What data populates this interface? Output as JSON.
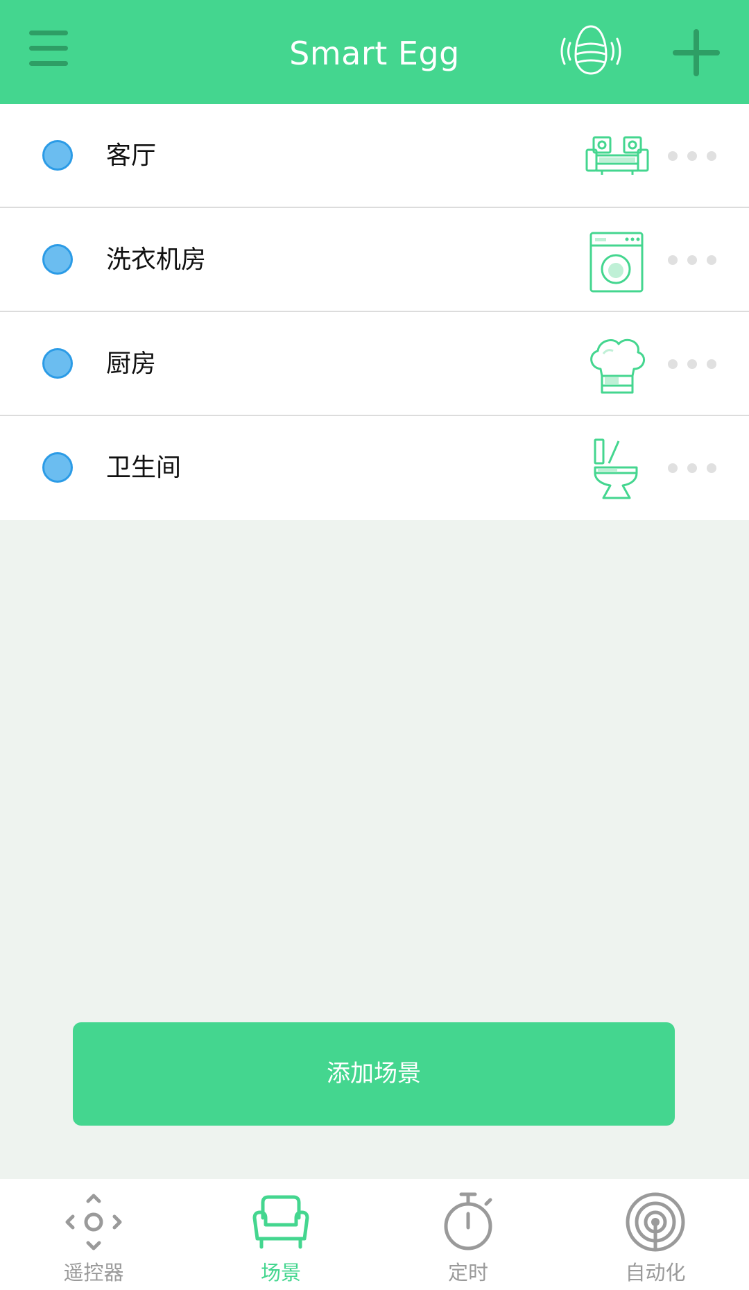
{
  "header": {
    "title": "Smart Egg",
    "menu_icon": "hamburger-menu-icon",
    "device_icon": "smart-egg-signal-icon",
    "add_icon": "plus-icon"
  },
  "scenes": [
    {
      "label": "客厅",
      "icon": "living-room-sofa-icon"
    },
    {
      "label": "洗衣机房",
      "icon": "washing-machine-icon"
    },
    {
      "label": "厨房",
      "icon": "chef-hat-icon"
    },
    {
      "label": "卫生间",
      "icon": "toilet-icon"
    }
  ],
  "add_scene": {
    "label": "添加场景"
  },
  "tabs": [
    {
      "label": "遥控器",
      "icon": "remote-dpad-icon",
      "active": false
    },
    {
      "label": "场景",
      "icon": "armchair-icon",
      "active": true
    },
    {
      "label": "定时",
      "icon": "stopwatch-icon",
      "active": false
    },
    {
      "label": "自动化",
      "icon": "target-signal-icon",
      "active": false
    }
  ],
  "colors": {
    "brand_green": "#44d68f",
    "status_dot_blue": "#6bbdf0",
    "inactive_gray": "#9a9a9a",
    "menu_dark_green": "#2e9e65"
  }
}
